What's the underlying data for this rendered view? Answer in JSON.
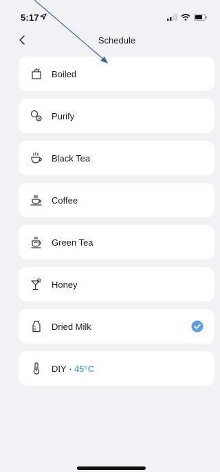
{
  "status_bar": {
    "time": "5:17"
  },
  "nav": {
    "title": "Schedule"
  },
  "items": [
    {
      "label": "Boiled",
      "icon": "kettle-icon",
      "selected": false
    },
    {
      "label": "Purify",
      "icon": "purify-icon",
      "selected": false
    },
    {
      "label": "Black Tea",
      "icon": "black-tea-icon",
      "selected": false
    },
    {
      "label": "Coffee",
      "icon": "coffee-icon",
      "selected": false
    },
    {
      "label": "Green Tea",
      "icon": "green-tea-icon",
      "selected": false
    },
    {
      "label": "Honey",
      "icon": "honey-icon",
      "selected": false
    },
    {
      "label": "Dried Milk",
      "icon": "milk-bottle-icon",
      "selected": true
    },
    {
      "label": "DIY",
      "separator": "·",
      "temperature": "45°C",
      "icon": "thermometer-icon",
      "selected": false
    }
  ],
  "colors": {
    "background": "#f2f2f4",
    "card": "#ffffff",
    "accent": "#6aa8e8",
    "check": "#5b9fe6",
    "annotation": "#3a63b8"
  }
}
